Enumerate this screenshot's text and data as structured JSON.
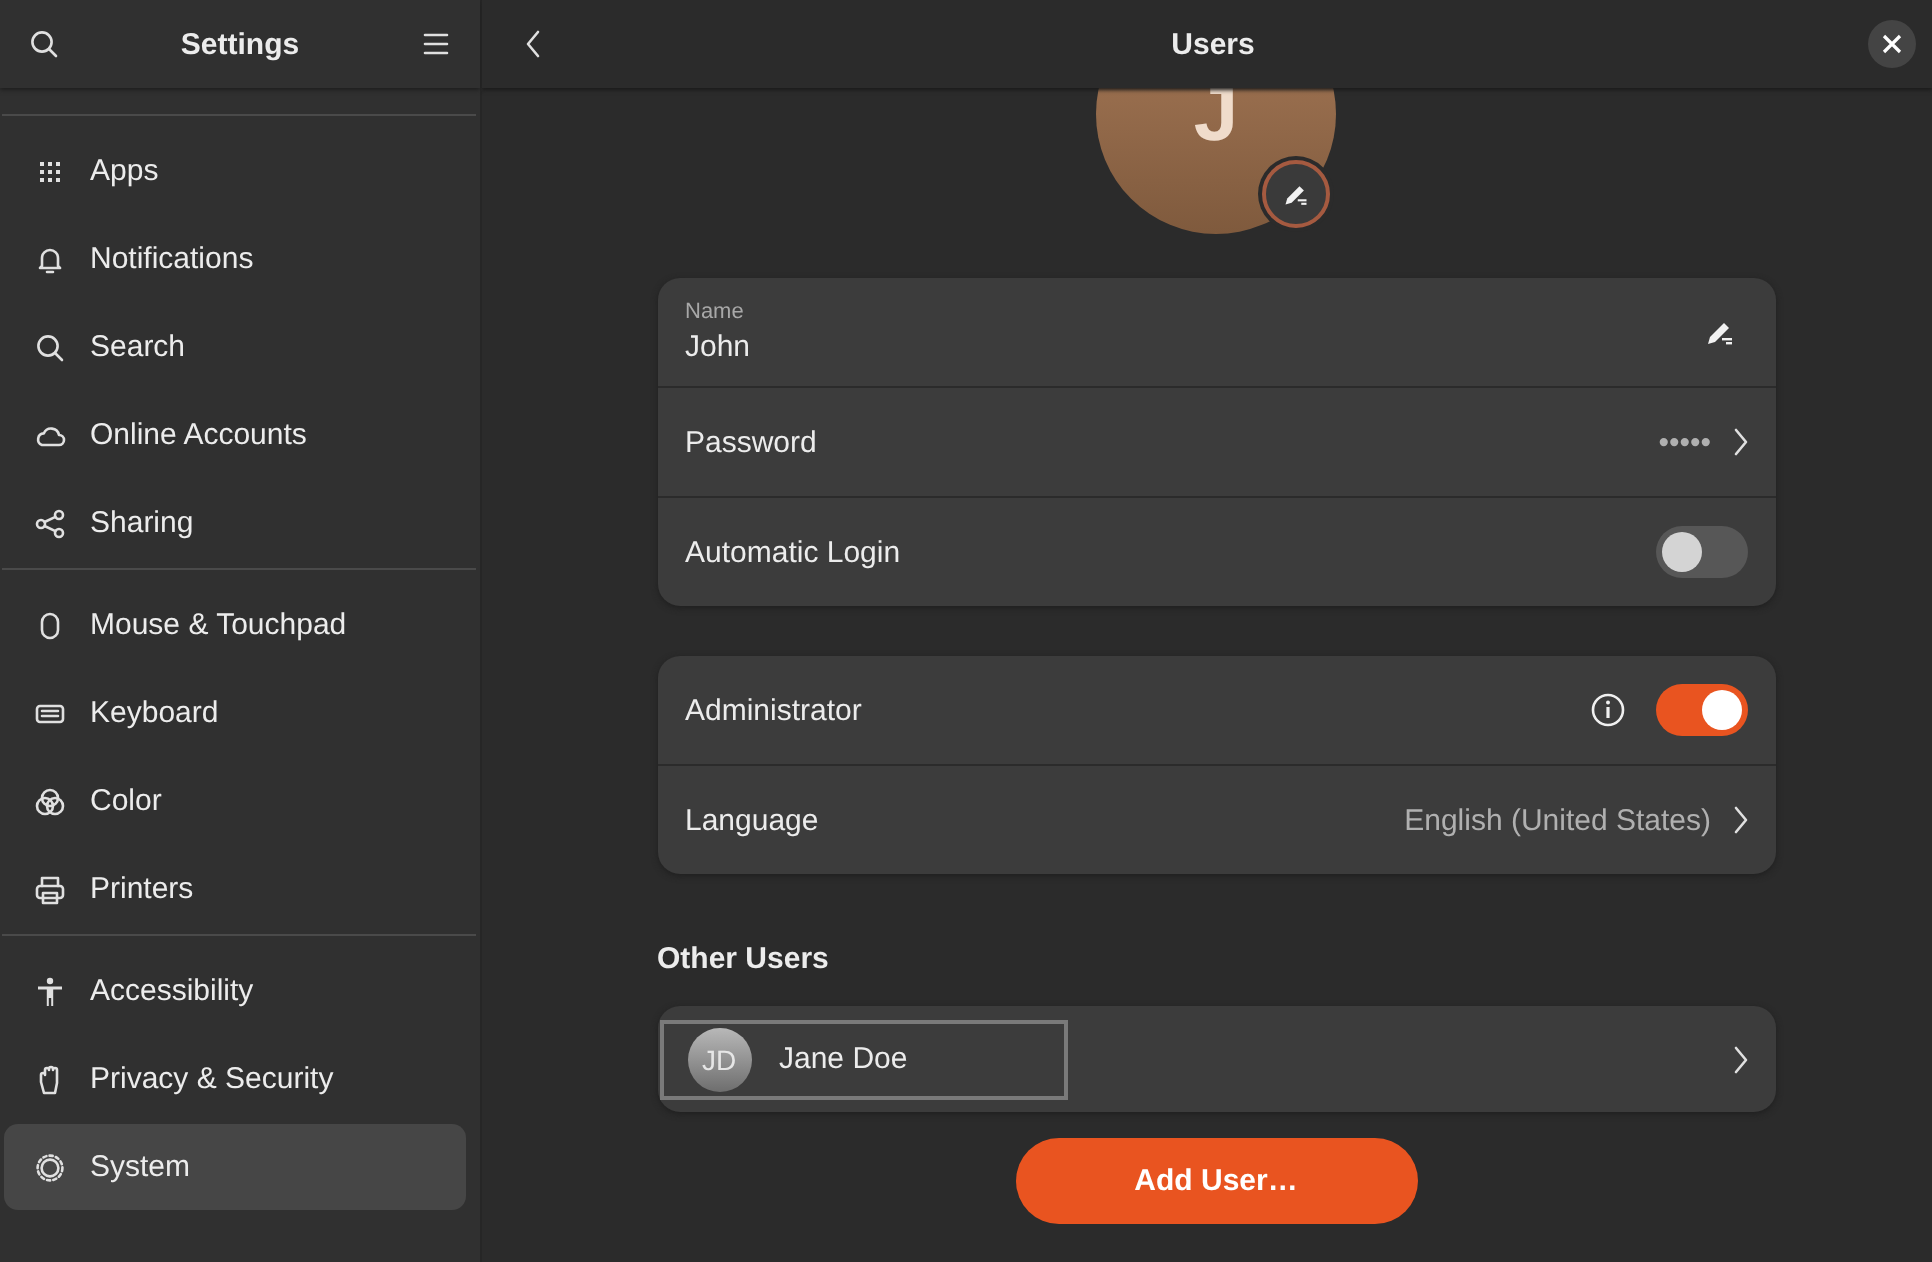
{
  "sidebar": {
    "title": "Settings",
    "groups": [
      {
        "items": [
          {
            "label": "Apps",
            "selected": false
          },
          {
            "label": "Notifications",
            "selected": false
          },
          {
            "label": "Search",
            "selected": false
          },
          {
            "label": "Online Accounts",
            "selected": false
          },
          {
            "label": "Sharing",
            "selected": false
          }
        ]
      },
      {
        "items": [
          {
            "label": "Mouse & Touchpad",
            "selected": false
          },
          {
            "label": "Keyboard",
            "selected": false
          },
          {
            "label": "Color",
            "selected": false
          },
          {
            "label": "Printers",
            "selected": false
          }
        ]
      },
      {
        "items": [
          {
            "label": "Accessibility",
            "selected": false
          },
          {
            "label": "Privacy & Security",
            "selected": false
          },
          {
            "label": "System",
            "selected": true
          }
        ]
      }
    ]
  },
  "header": {
    "title": "Users"
  },
  "profile": {
    "initial": "J"
  },
  "account_rows": [
    {
      "kind": "entry",
      "label": "Name",
      "value": "John"
    },
    {
      "kind": "link",
      "label": "Password",
      "value": "•••••"
    },
    {
      "kind": "switch",
      "label": "Automatic Login",
      "on": false
    }
  ],
  "permission_rows": [
    {
      "kind": "switch",
      "label": "Administrator",
      "on": true,
      "info": true
    },
    {
      "kind": "link",
      "label": "Language",
      "value": "English (United States)"
    }
  ],
  "other_users": {
    "title": "Other Users",
    "users": [
      {
        "initials": "JD",
        "name": "Jane Doe",
        "focused": true
      }
    ]
  },
  "add_button": "Add User…"
}
